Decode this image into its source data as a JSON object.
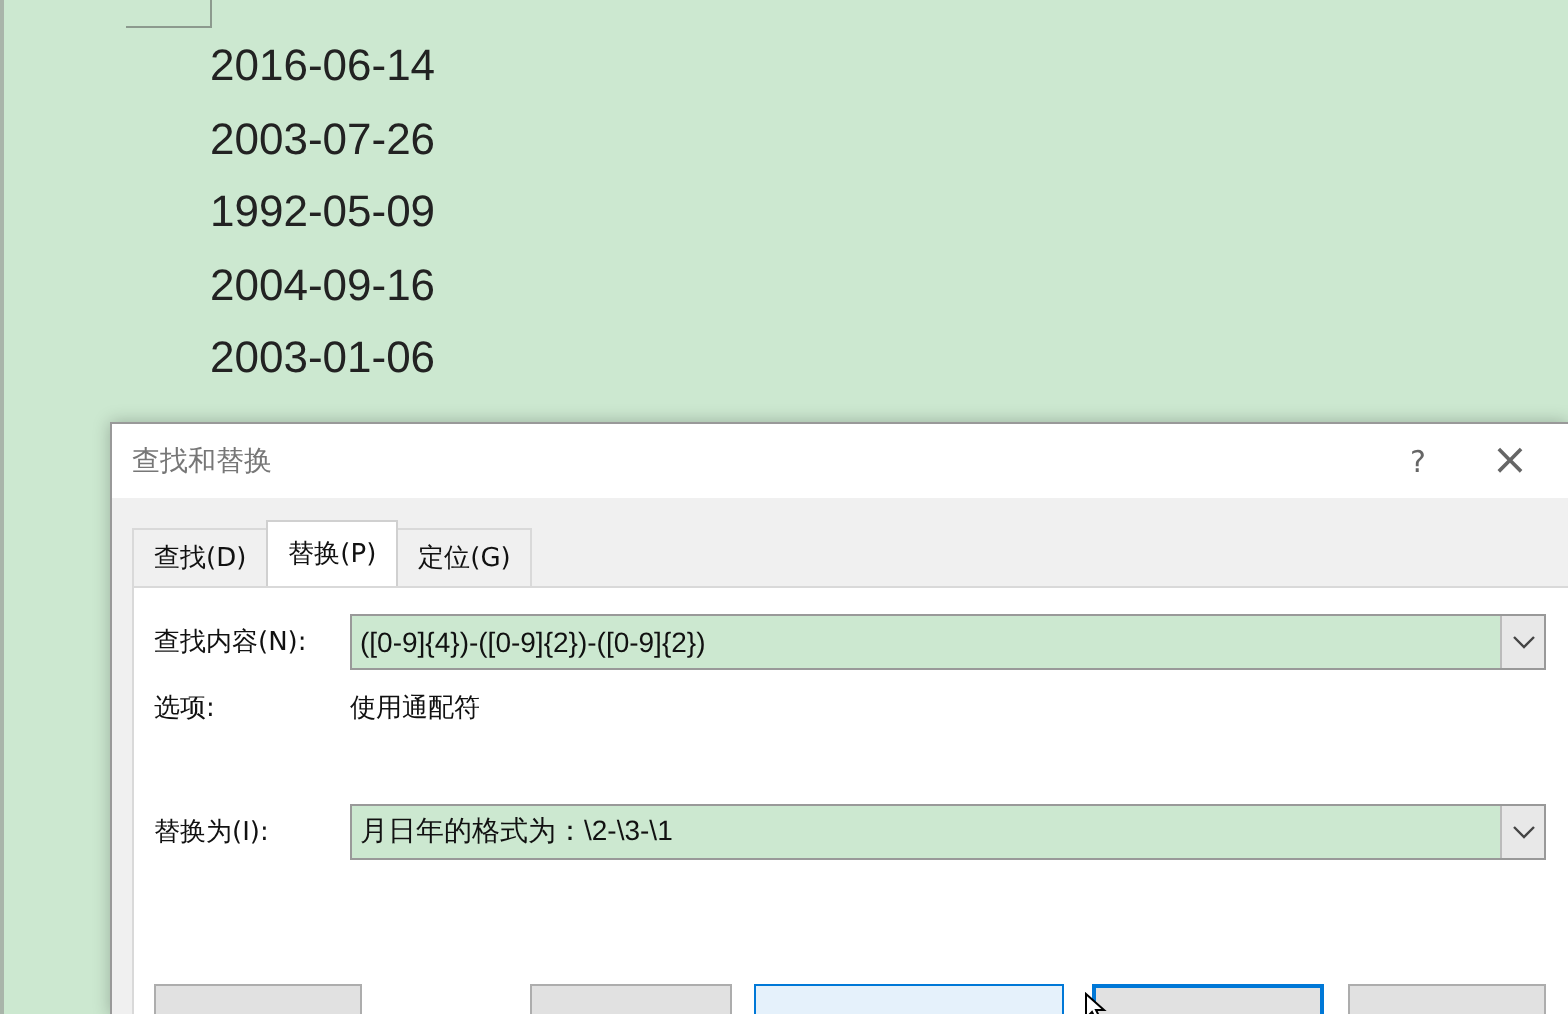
{
  "document": {
    "lines": [
      "2016-06-14",
      "2003-07-26",
      "1992-05-09",
      "2004-09-16",
      "2003-01-06"
    ]
  },
  "dialog": {
    "title": "查找和替换",
    "help": "?",
    "close": "×",
    "tabs": [
      {
        "label": "查找(D)",
        "selected": false
      },
      {
        "label": "替换(P)",
        "selected": true
      },
      {
        "label": "定位(G)",
        "selected": false
      }
    ],
    "find": {
      "label": "查找内容(N):",
      "value": "([0-9]{4})-([0-9]{2})-([0-9]{2})"
    },
    "options": {
      "label": "选项:",
      "value": "使用通配符"
    },
    "replace": {
      "label": "替换为(I):",
      "value": "月日年的格式为：\\2-\\3-\\1"
    },
    "buttons": [
      {
        "kind": "plain"
      },
      {
        "kind": "plain"
      },
      {
        "kind": "hover"
      },
      {
        "kind": "default"
      },
      {
        "kind": "plain"
      }
    ]
  }
}
